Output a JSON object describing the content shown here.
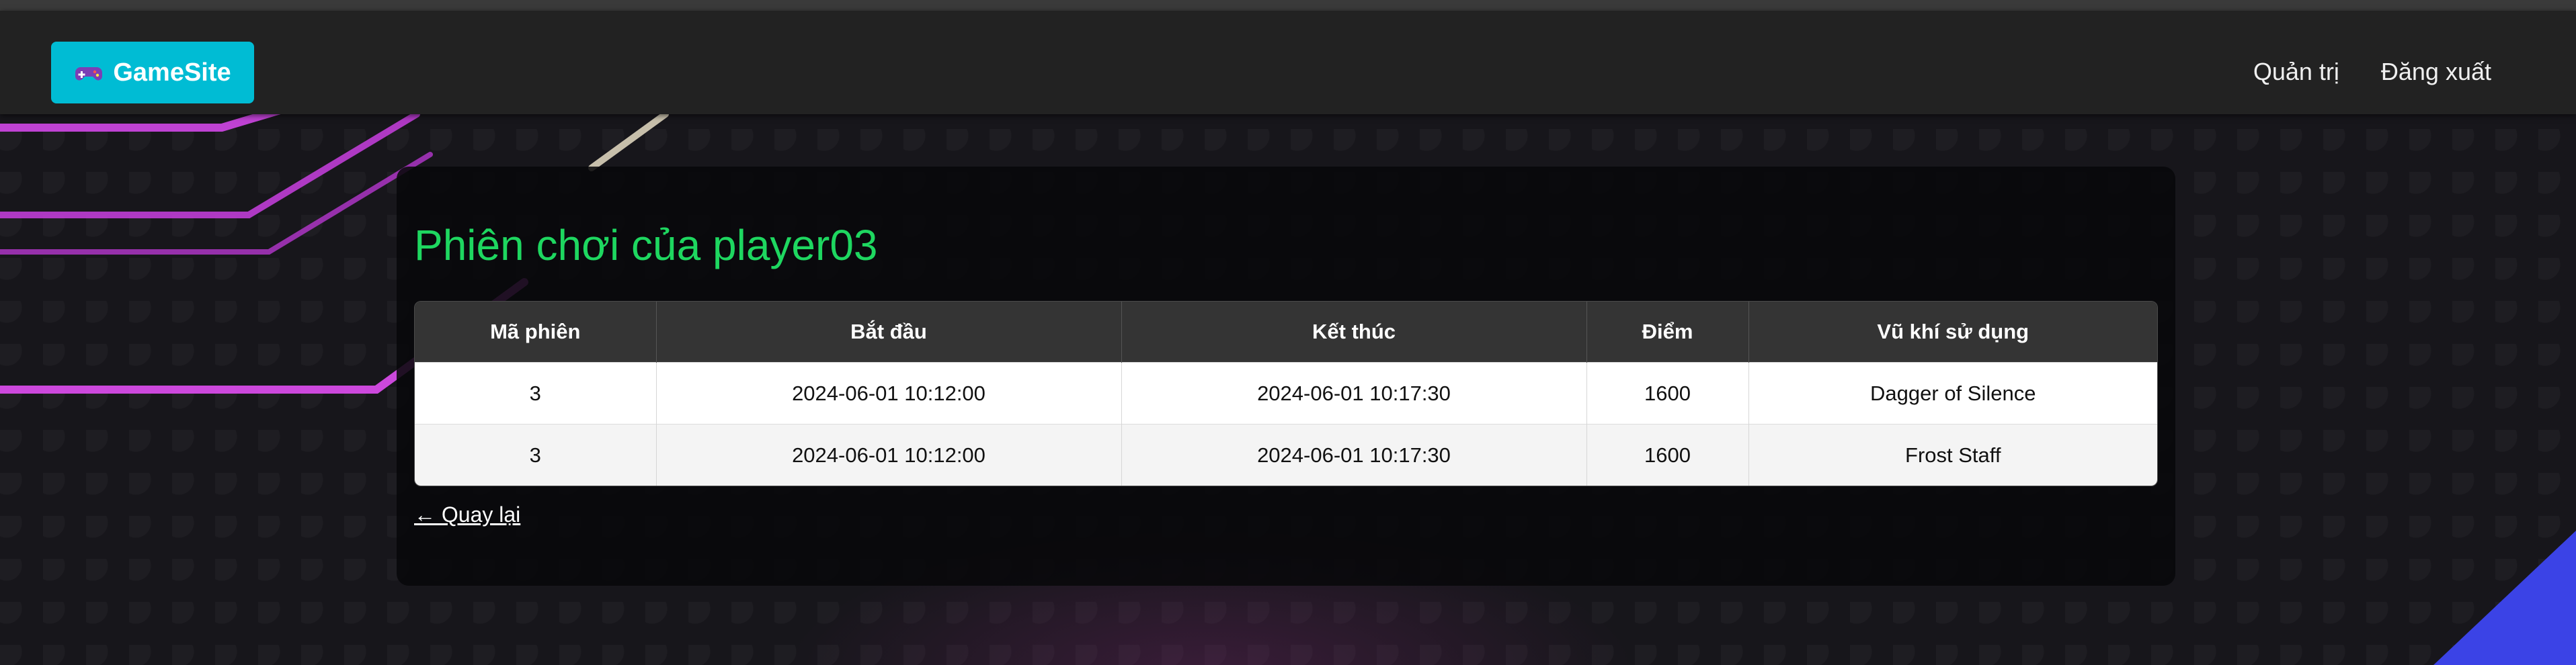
{
  "navbar": {
    "brand": {
      "icon": "gamepad-icon",
      "label": "GameSite"
    },
    "links": [
      {
        "label": "Quản trị"
      },
      {
        "label": "Đăng xuất"
      }
    ]
  },
  "main": {
    "title": "Phiên chơi của player03",
    "table": {
      "headers": [
        "Mã phiên",
        "Bắt đầu",
        "Kết thúc",
        "Điểm",
        "Vũ khí sử dụng"
      ],
      "rows": [
        [
          "3",
          "2024-06-01 10:12:00",
          "2024-06-01 10:17:30",
          "1600",
          "Dagger of Silence"
        ],
        [
          "3",
          "2024-06-01 10:12:00",
          "2024-06-01 10:17:30",
          "1600",
          "Frost Staff"
        ]
      ]
    },
    "back_link": "← Quay lại"
  },
  "colors": {
    "brand_bg": "#00bcd4",
    "title": "#1ed760",
    "navbar_bg": "#222222",
    "header_bg": "#343434"
  }
}
